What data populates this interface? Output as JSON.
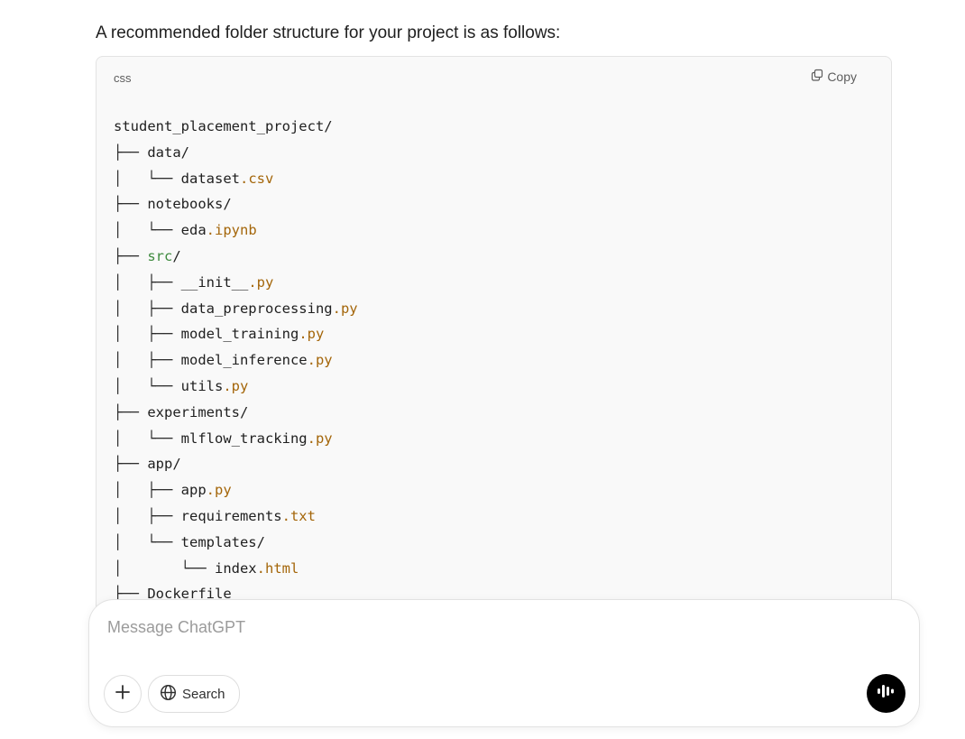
{
  "message": {
    "intro": "A recommended folder structure for your project is as follows:"
  },
  "code_block": {
    "language": "css",
    "copy_label": "Copy",
    "lines": [
      {
        "tree": "",
        "name": "student_placement_project/",
        "ext": ""
      },
      {
        "tree": "├── ",
        "name": "data/",
        "ext": ""
      },
      {
        "tree": "│   └── ",
        "name": "dataset",
        "ext": ".csv"
      },
      {
        "tree": "├── ",
        "name": "notebooks/",
        "ext": ""
      },
      {
        "tree": "│   └── ",
        "name": "eda",
        "ext": ".ipynb"
      },
      {
        "tree": "├── ",
        "name": "src",
        "ext": "/",
        "green_name": true
      },
      {
        "tree": "│   ├── ",
        "name": "__init__",
        "ext": ".py"
      },
      {
        "tree": "│   ├── ",
        "name": "data_preprocessing",
        "ext": ".py"
      },
      {
        "tree": "│   ├── ",
        "name": "model_training",
        "ext": ".py"
      },
      {
        "tree": "│   ├── ",
        "name": "model_inference",
        "ext": ".py"
      },
      {
        "tree": "│   └── ",
        "name": "utils",
        "ext": ".py"
      },
      {
        "tree": "├── ",
        "name": "experiments/",
        "ext": ""
      },
      {
        "tree": "│   └── ",
        "name": "mlflow_tracking",
        "ext": ".py"
      },
      {
        "tree": "├── ",
        "name": "app/",
        "ext": ""
      },
      {
        "tree": "│   ├── ",
        "name": "app",
        "ext": ".py"
      },
      {
        "tree": "│   ├── ",
        "name": "requirements",
        "ext": ".txt"
      },
      {
        "tree": "│   └── ",
        "name": "templates/",
        "ext": ""
      },
      {
        "tree": "│       └── ",
        "name": "index",
        "ext": ".html"
      },
      {
        "tree": "├── ",
        "name": "Dockerfile",
        "ext": ""
      }
    ]
  },
  "composer": {
    "placeholder": "Message ChatGPT",
    "search_label": "Search",
    "icons": {
      "attach": "plus-icon",
      "search": "globe-icon",
      "voice": "voice-waveform-icon",
      "copy": "copy-icon"
    }
  }
}
